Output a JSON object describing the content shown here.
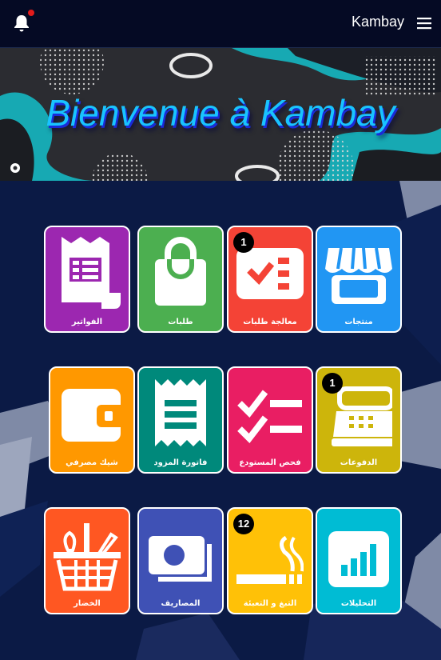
{
  "header": {
    "title": "Kambay",
    "notification_icon": "bell-icon",
    "menu_icon": "hamburger-menu-icon",
    "notification_dot_color": "#e21b1b"
  },
  "banner": {
    "title": "Bienvenue à Kambay"
  },
  "tiles": [
    {
      "id": "factures",
      "label": "الفواتير",
      "icon": "invoice-icon",
      "color": "#9c27b0"
    },
    {
      "id": "commandes",
      "label": "طلبات",
      "icon": "shopping-bag-icon",
      "color": "#4caf50"
    },
    {
      "id": "traitement",
      "label": "معالجة طلبات",
      "icon": "checklist-icon",
      "color": "#f44336",
      "badge": "1"
    },
    {
      "id": "produits",
      "label": "منتجات",
      "icon": "storefront-icon",
      "color": "#2196f3"
    },
    {
      "id": "cheque",
      "label": "شيك مصرفي",
      "icon": "wallet-icon",
      "color": "#ff9800"
    },
    {
      "id": "facture-fournisseur",
      "label": "فاتورة المزود",
      "icon": "receipt-icon",
      "color": "#00897b"
    },
    {
      "id": "inventaire",
      "label": "فحص المستودع",
      "icon": "checkbox-list-icon",
      "color": "#e91e63"
    },
    {
      "id": "paiements",
      "label": "الدفوعات",
      "icon": "cash-register-icon",
      "color": "#cdb50b",
      "badge": "1"
    },
    {
      "id": "legumes",
      "label": "الخضار",
      "icon": "vegetable-basket-icon",
      "color": "#ff5722"
    },
    {
      "id": "depenses",
      "label": "المصاريف",
      "icon": "money-icon",
      "color": "#3f51b5"
    },
    {
      "id": "tabac",
      "label": "التبغ و التعبئة",
      "icon": "cigarette-icon",
      "color": "#ffc107",
      "badge": "12"
    },
    {
      "id": "analyses",
      "label": "التحليلات",
      "icon": "bar-chart-icon",
      "color": "#00bcd4"
    }
  ]
}
